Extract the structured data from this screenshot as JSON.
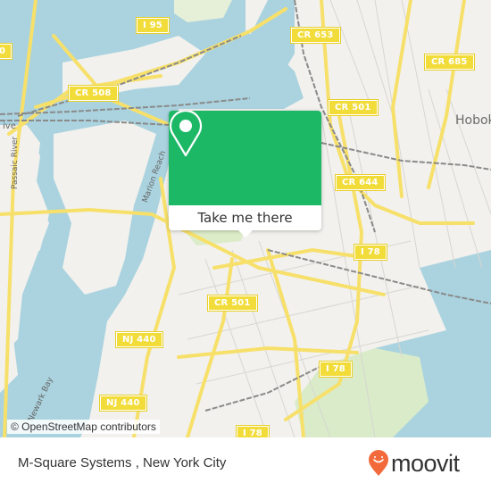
{
  "map": {
    "road_shields": [
      {
        "id": "i95",
        "label": "I 95"
      },
      {
        "id": "cr653",
        "label": "CR 653"
      },
      {
        "id": "cr685",
        "label": "CR 685"
      },
      {
        "id": "cr508",
        "label": "CR 508"
      },
      {
        "id": "cr501-north",
        "label": "CR 501"
      },
      {
        "id": "cr644",
        "label": "CR 644"
      },
      {
        "id": "i78-east",
        "label": "I 78"
      },
      {
        "id": "cr501-south",
        "label": "CR 501"
      },
      {
        "id": "nj440-north",
        "label": "NJ 440"
      },
      {
        "id": "nj440-south",
        "label": "NJ 440"
      },
      {
        "id": "i78-southeast",
        "label": "I 78"
      },
      {
        "id": "i78-bottom",
        "label": "I 78"
      },
      {
        "id": "edge-left",
        "label": "0"
      }
    ],
    "place_labels": {
      "hoboken": "Hobok"
    },
    "water_labels": {
      "passaic_river": "Passaic River",
      "newark_bay": "Newark Bay",
      "marion_reach": "Marion Reach",
      "river_fragment": "ive"
    },
    "attribution": "© OpenStreetMap contributors"
  },
  "popup": {
    "icon": "location-pin-icon",
    "action_label": "Take me there",
    "accent_color": "#1db866"
  },
  "footer": {
    "location_title": "M-Square Systems , New York City",
    "brand_name": "moovit",
    "brand_color": "#f26a3c"
  }
}
